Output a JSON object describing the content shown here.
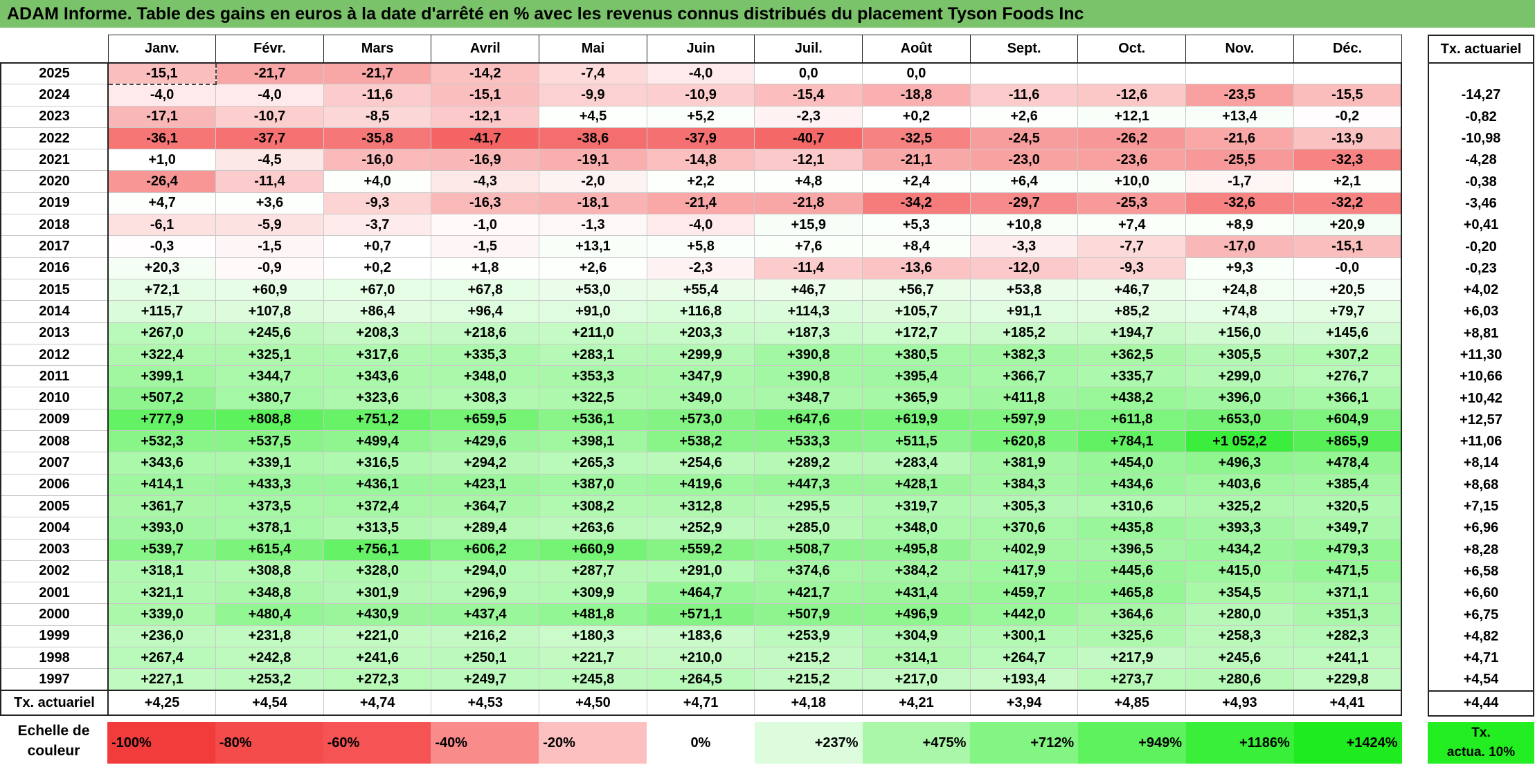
{
  "title": "ADAM Informe. Table des gains en euros à la date d'arrêté en % avec les revenus connus distribués du placement Tyson Foods Inc",
  "months": [
    "Janv.",
    "Févr.",
    "Mars",
    "Avril",
    "Mai",
    "Juin",
    "Juil.",
    "Août",
    "Sept.",
    "Oct.",
    "Nov.",
    "Déc."
  ],
  "annual_header": "Tx. actuariel",
  "rows": [
    {
      "year": "2025",
      "values": [
        "-15,1",
        "-21,7",
        "-21,7",
        "-14,2",
        "-7,4",
        "-4,0",
        "0,0",
        "0,0",
        "",
        "",
        "",
        ""
      ],
      "annual": ""
    },
    {
      "year": "2024",
      "values": [
        "-4,0",
        "-4,0",
        "-11,6",
        "-15,1",
        "-9,9",
        "-10,9",
        "-15,4",
        "-18,8",
        "-11,6",
        "-12,6",
        "-23,5",
        "-15,5"
      ],
      "annual": "-14,27"
    },
    {
      "year": "2023",
      "values": [
        "-17,1",
        "-10,7",
        "-8,5",
        "-12,1",
        "+4,5",
        "+5,2",
        "-2,3",
        "+0,2",
        "+2,6",
        "+12,1",
        "+13,4",
        "-0,2"
      ],
      "annual": "-0,82"
    },
    {
      "year": "2022",
      "values": [
        "-36,1",
        "-37,7",
        "-35,8",
        "-41,7",
        "-38,6",
        "-37,9",
        "-40,7",
        "-32,5",
        "-24,5",
        "-26,2",
        "-21,6",
        "-13,9"
      ],
      "annual": "-10,98"
    },
    {
      "year": "2021",
      "values": [
        "+1,0",
        "-4,5",
        "-16,0",
        "-16,9",
        "-19,1",
        "-14,8",
        "-12,1",
        "-21,1",
        "-23,0",
        "-23,6",
        "-25,5",
        "-32,3"
      ],
      "annual": "-4,28"
    },
    {
      "year": "2020",
      "values": [
        "-26,4",
        "-11,4",
        "+4,0",
        "-4,3",
        "-2,0",
        "+2,2",
        "+4,8",
        "+2,4",
        "+6,4",
        "+10,0",
        "-1,7",
        "+2,1"
      ],
      "annual": "-0,38"
    },
    {
      "year": "2019",
      "values": [
        "+4,7",
        "+3,6",
        "-9,3",
        "-16,3",
        "-18,1",
        "-21,4",
        "-21,8",
        "-34,2",
        "-29,7",
        "-25,3",
        "-32,6",
        "-32,2"
      ],
      "annual": "-3,46"
    },
    {
      "year": "2018",
      "values": [
        "-6,1",
        "-5,9",
        "-3,7",
        "-1,0",
        "-1,3",
        "-4,0",
        "+15,9",
        "+5,3",
        "+10,8",
        "+7,4",
        "+8,9",
        "+20,9"
      ],
      "annual": "+0,41"
    },
    {
      "year": "2017",
      "values": [
        "-0,3",
        "-1,5",
        "+0,7",
        "-1,5",
        "+13,1",
        "+5,8",
        "+7,6",
        "+8,4",
        "-3,3",
        "-7,7",
        "-17,0",
        "-15,1"
      ],
      "annual": "-0,20"
    },
    {
      "year": "2016",
      "values": [
        "+20,3",
        "-0,9",
        "+0,2",
        "+1,8",
        "+2,6",
        "-2,3",
        "-11,4",
        "-13,6",
        "-12,0",
        "-9,3",
        "+9,3",
        "-0,0"
      ],
      "annual": "-0,23"
    },
    {
      "year": "2015",
      "values": [
        "+72,1",
        "+60,9",
        "+67,0",
        "+67,8",
        "+53,0",
        "+55,4",
        "+46,7",
        "+56,7",
        "+53,8",
        "+46,7",
        "+24,8",
        "+20,5"
      ],
      "annual": "+4,02"
    },
    {
      "year": "2014",
      "values": [
        "+115,7",
        "+107,8",
        "+86,4",
        "+96,4",
        "+91,0",
        "+116,8",
        "+114,3",
        "+105,7",
        "+91,1",
        "+85,2",
        "+74,8",
        "+79,7"
      ],
      "annual": "+6,03"
    },
    {
      "year": "2013",
      "values": [
        "+267,0",
        "+245,6",
        "+208,3",
        "+218,6",
        "+211,0",
        "+203,3",
        "+187,3",
        "+172,7",
        "+185,2",
        "+194,7",
        "+156,0",
        "+145,6"
      ],
      "annual": "+8,81"
    },
    {
      "year": "2012",
      "values": [
        "+322,4",
        "+325,1",
        "+317,6",
        "+335,3",
        "+283,1",
        "+299,9",
        "+390,8",
        "+380,5",
        "+382,3",
        "+362,5",
        "+305,5",
        "+307,2"
      ],
      "annual": "+11,30"
    },
    {
      "year": "2011",
      "values": [
        "+399,1",
        "+344,7",
        "+343,6",
        "+348,0",
        "+353,3",
        "+347,9",
        "+390,8",
        "+395,4",
        "+366,7",
        "+335,7",
        "+299,0",
        "+276,7"
      ],
      "annual": "+10,66"
    },
    {
      "year": "2010",
      "values": [
        "+507,2",
        "+380,7",
        "+323,6",
        "+308,3",
        "+322,5",
        "+349,0",
        "+348,7",
        "+365,9",
        "+411,8",
        "+438,2",
        "+396,0",
        "+366,1"
      ],
      "annual": "+10,42"
    },
    {
      "year": "2009",
      "values": [
        "+777,9",
        "+808,8",
        "+751,2",
        "+659,5",
        "+536,1",
        "+573,0",
        "+647,6",
        "+619,9",
        "+597,9",
        "+611,8",
        "+653,0",
        "+604,9"
      ],
      "annual": "+12,57"
    },
    {
      "year": "2008",
      "values": [
        "+532,3",
        "+537,5",
        "+499,4",
        "+429,6",
        "+398,1",
        "+538,2",
        "+533,3",
        "+511,5",
        "+620,8",
        "+784,1",
        "+1 052,2",
        "+865,9"
      ],
      "annual": "+11,06"
    },
    {
      "year": "2007",
      "values": [
        "+343,6",
        "+339,1",
        "+316,5",
        "+294,2",
        "+265,3",
        "+254,6",
        "+289,2",
        "+283,4",
        "+381,9",
        "+454,0",
        "+496,3",
        "+478,4"
      ],
      "annual": "+8,14"
    },
    {
      "year": "2006",
      "values": [
        "+414,1",
        "+433,3",
        "+436,1",
        "+423,1",
        "+387,0",
        "+419,6",
        "+447,3",
        "+428,1",
        "+384,3",
        "+434,6",
        "+403,6",
        "+385,4"
      ],
      "annual": "+8,68"
    },
    {
      "year": "2005",
      "values": [
        "+361,7",
        "+373,5",
        "+372,4",
        "+364,7",
        "+308,2",
        "+312,8",
        "+295,5",
        "+319,7",
        "+305,3",
        "+310,6",
        "+325,2",
        "+320,5"
      ],
      "annual": "+7,15"
    },
    {
      "year": "2004",
      "values": [
        "+393,0",
        "+378,1",
        "+313,5",
        "+289,4",
        "+263,6",
        "+252,9",
        "+285,0",
        "+348,0",
        "+370,6",
        "+435,8",
        "+393,3",
        "+349,7"
      ],
      "annual": "+6,96"
    },
    {
      "year": "2003",
      "values": [
        "+539,7",
        "+615,4",
        "+756,1",
        "+606,2",
        "+660,9",
        "+559,2",
        "+508,7",
        "+495,8",
        "+402,9",
        "+396,5",
        "+434,2",
        "+479,3"
      ],
      "annual": "+8,28"
    },
    {
      "year": "2002",
      "values": [
        "+318,1",
        "+308,8",
        "+328,0",
        "+294,0",
        "+287,7",
        "+291,0",
        "+374,6",
        "+384,2",
        "+417,9",
        "+445,6",
        "+415,0",
        "+471,5"
      ],
      "annual": "+6,58"
    },
    {
      "year": "2001",
      "values": [
        "+321,1",
        "+348,8",
        "+301,9",
        "+296,9",
        "+309,9",
        "+464,7",
        "+421,7",
        "+431,4",
        "+459,7",
        "+465,8",
        "+354,5",
        "+371,1"
      ],
      "annual": "+6,60"
    },
    {
      "year": "2000",
      "values": [
        "+339,0",
        "+480,4",
        "+430,9",
        "+437,4",
        "+481,8",
        "+571,1",
        "+507,9",
        "+496,9",
        "+442,0",
        "+364,6",
        "+280,0",
        "+351,3"
      ],
      "annual": "+6,75"
    },
    {
      "year": "1999",
      "values": [
        "+236,0",
        "+231,8",
        "+221,0",
        "+216,2",
        "+180,3",
        "+183,6",
        "+253,9",
        "+304,9",
        "+300,1",
        "+325,6",
        "+258,3",
        "+282,3"
      ],
      "annual": "+4,82"
    },
    {
      "year": "1998",
      "values": [
        "+267,4",
        "+242,8",
        "+241,6",
        "+250,1",
        "+221,7",
        "+210,0",
        "+215,2",
        "+314,1",
        "+264,7",
        "+217,9",
        "+245,6",
        "+241,1"
      ],
      "annual": "+4,71"
    },
    {
      "year": "1997",
      "values": [
        "+227,1",
        "+253,2",
        "+272,3",
        "+249,7",
        "+245,8",
        "+264,5",
        "+215,2",
        "+217,0",
        "+193,4",
        "+273,7",
        "+280,6",
        "+229,8"
      ],
      "annual": "+4,54"
    }
  ],
  "footer": {
    "label": "Tx. actuariel",
    "values": [
      "+4,25",
      "+4,54",
      "+4,74",
      "+4,53",
      "+4,50",
      "+4,71",
      "+4,18",
      "+4,21",
      "+3,94",
      "+4,85",
      "+4,93",
      "+4,41"
    ],
    "annual": "+4,44"
  },
  "scale": {
    "label_line1": "Echelle de",
    "label_line2": "couleur",
    "swatches": [
      {
        "label": "-100%",
        "color": "#f23c3c",
        "align": "left"
      },
      {
        "label": "-80%",
        "color": "#f44b4b",
        "align": "left"
      },
      {
        "label": "-60%",
        "color": "#f65454",
        "align": "left"
      },
      {
        "label": "-40%",
        "color": "#f98b8b",
        "align": "left"
      },
      {
        "label": "-20%",
        "color": "#fcc0c0",
        "align": "left"
      },
      {
        "label": "0%",
        "color": "#ffffff",
        "align": "center"
      },
      {
        "label": "+237%",
        "color": "#ddfcdd",
        "align": "right"
      },
      {
        "label": "+475%",
        "color": "#aaf7aa",
        "align": "right"
      },
      {
        "label": "+712%",
        "color": "#82f582",
        "align": "right"
      },
      {
        "label": "+949%",
        "color": "#5ef25e",
        "align": "right"
      },
      {
        "label": "+1186%",
        "color": "#3aef3a",
        "align": "right"
      },
      {
        "label": "+1424%",
        "color": "#1eec1e",
        "align": "right"
      }
    ],
    "actua_line1": "Tx.",
    "actua_line2": "actua. 10%",
    "actua_color": "#22ee22"
  }
}
